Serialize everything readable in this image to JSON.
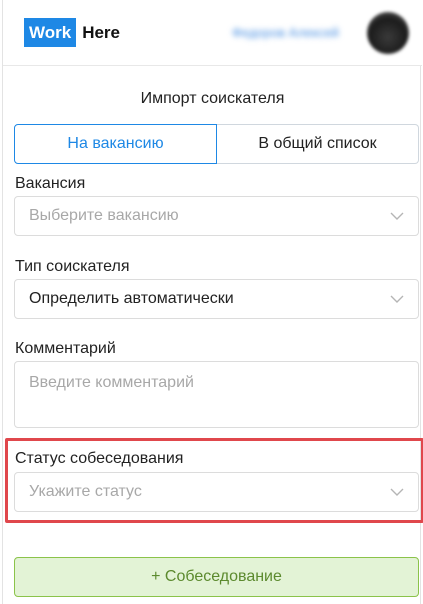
{
  "header": {
    "logo_work": "Work",
    "logo_here": "Here",
    "user_name": "Федоров Алексей"
  },
  "page_title": "Импорт соискателя",
  "tabs": [
    {
      "label": "На вакансию",
      "active": true
    },
    {
      "label": "В общий список",
      "active": false
    }
  ],
  "vacancy": {
    "label": "Вакансия",
    "placeholder": "Выберите вакансию"
  },
  "candidate_type": {
    "label": "Тип соискателя",
    "value": "Определить автоматически"
  },
  "comment": {
    "label": "Комментарий",
    "placeholder": "Введите комментарий"
  },
  "interview_status": {
    "label": "Статус собеседования",
    "placeholder": "Укажите статус"
  },
  "interview_button": {
    "label": "+ Собеседование"
  },
  "colors": {
    "accent": "#1e88e5",
    "highlight": "#e0474c",
    "button_bg": "#e3f3d6",
    "button_border": "#8bc34a"
  }
}
